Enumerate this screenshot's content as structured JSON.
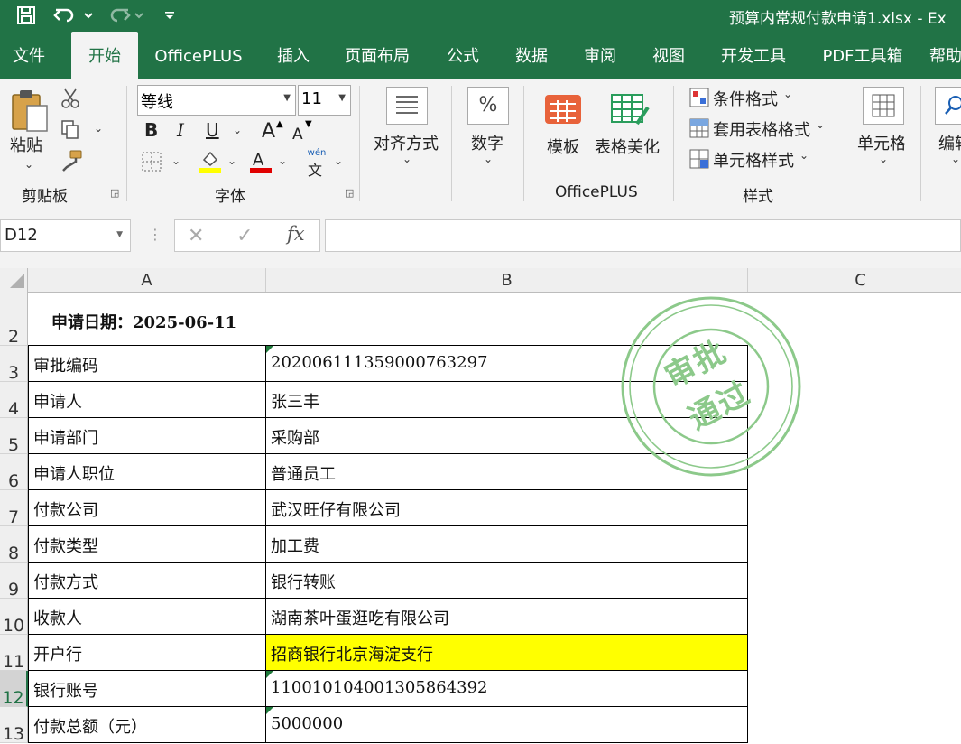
{
  "window": {
    "title": "预算内常规付款申请1.xlsx  -  Ex"
  },
  "quick_access": [
    {
      "name": "save-icon"
    },
    {
      "name": "undo-icon"
    },
    {
      "name": "redo-icon"
    },
    {
      "name": "customize-toolbar-icon"
    }
  ],
  "ribbon_tabs": [
    "文件",
    "开始",
    "OfficePLUS",
    "插入",
    "页面布局",
    "公式",
    "数据",
    "审阅",
    "视图",
    "开发工具",
    "PDF工具箱",
    "帮助"
  ],
  "active_tab": "开始",
  "ribbon": {
    "clipboard": {
      "paste_label": "粘贴",
      "group_label": "剪贴板"
    },
    "font": {
      "font_name": "等线",
      "font_size": "11",
      "bold": "B",
      "italic": "I",
      "underline": "U",
      "grow": "A",
      "shrink": "A",
      "phonetic_top": "wén",
      "phonetic_bottom": "文",
      "group_label": "字体",
      "fill_color": "#ffff00",
      "font_color": "#e00000"
    },
    "alignment": {
      "label": "对齐方式"
    },
    "number": {
      "icon_text": "%",
      "label": "数字"
    },
    "officeplus": {
      "template_label": "模板",
      "beautify_label": "表格美化",
      "group_label": "OfficePLUS"
    },
    "styles": {
      "conditional": "条件格式",
      "table_format": "套用表格格式",
      "cell_styles": "单元格样式",
      "group_label": "样式"
    },
    "cells": {
      "label": "单元格"
    },
    "editing": {
      "label": "编辑"
    }
  },
  "formula_bar": {
    "name_box": "D12",
    "fx": "fx",
    "formula": ""
  },
  "columns": [
    "A",
    "B",
    "C"
  ],
  "rows": [
    {
      "num": "2",
      "a": "申请日期：2025-06-11",
      "b": ""
    },
    {
      "num": "3",
      "a": "审批编码",
      "b": "202006111359000763297"
    },
    {
      "num": "4",
      "a": "申请人",
      "b": "张三丰"
    },
    {
      "num": "5",
      "a": "申请部门",
      "b": "采购部"
    },
    {
      "num": "6",
      "a": "申请人职位",
      "b": "普通员工"
    },
    {
      "num": "7",
      "a": "付款公司",
      "b": "武汉旺仔有限公司"
    },
    {
      "num": "8",
      "a": "付款类型",
      "b": "加工费"
    },
    {
      "num": "9",
      "a": "付款方式",
      "b": "银行转账"
    },
    {
      "num": "10",
      "a": "收款人",
      "b": "湖南茶叶蛋逛吃有限公司"
    },
    {
      "num": "11",
      "a": "开户行",
      "b": "招商银行北京海淀支行"
    },
    {
      "num": "12",
      "a": "银行账号",
      "b": "110010104001305864392"
    },
    {
      "num": "13",
      "a": "付款总额（元）",
      "b": "5000000"
    }
  ],
  "highlight_row": "11",
  "highlight_color": "#ffff00",
  "selected_row": "12",
  "stamp": {
    "line1": "审批",
    "line2": "通过",
    "color": "#8cc98a"
  }
}
